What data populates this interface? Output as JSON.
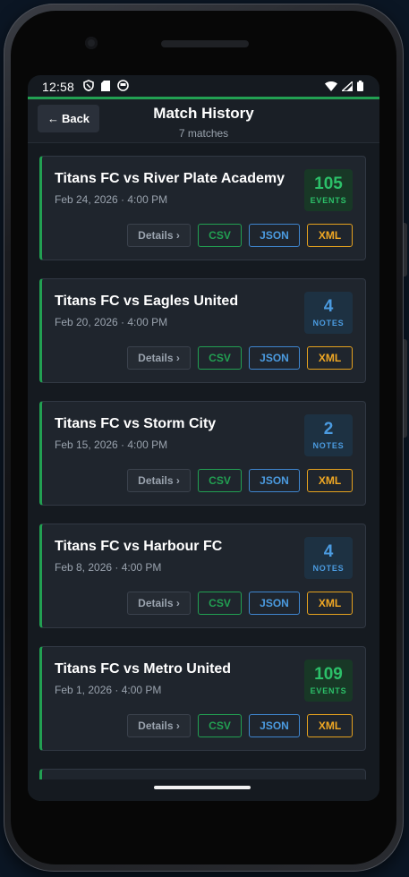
{
  "status_bar": {
    "time": "12:58"
  },
  "header": {
    "back_label": "Back",
    "title": "Match History",
    "subtitle": "7 matches"
  },
  "matches": [
    {
      "title": "Titans FC vs River Plate Academy",
      "date": "Feb 24, 2026 · 4:00 PM",
      "badge_value": "105",
      "badge_label": "EVENTS",
      "badge_type": "events"
    },
    {
      "title": "Titans FC vs Eagles United",
      "date": "Feb 20, 2026 · 4:00 PM",
      "badge_value": "4",
      "badge_label": "NOTES",
      "badge_type": "notes"
    },
    {
      "title": "Titans FC vs Storm City",
      "date": "Feb 15, 2026 · 4:00 PM",
      "badge_value": "2",
      "badge_label": "NOTES",
      "badge_type": "notes"
    },
    {
      "title": "Titans FC vs Harbour FC",
      "date": "Feb 8, 2026 · 4:00 PM",
      "badge_value": "4",
      "badge_label": "NOTES",
      "badge_type": "notes"
    },
    {
      "title": "Titans FC vs Metro United",
      "date": "Feb 1, 2026 · 4:00 PM",
      "badge_value": "109",
      "badge_label": "EVENTS",
      "badge_type": "events"
    }
  ],
  "actions": {
    "details": "Details ›",
    "csv": "CSV",
    "json": "JSON",
    "xml": "XML"
  },
  "colors": {
    "accent": "#22a052",
    "events": "#2cc069",
    "notes": "#4b9be0",
    "xml": "#f0a824"
  }
}
